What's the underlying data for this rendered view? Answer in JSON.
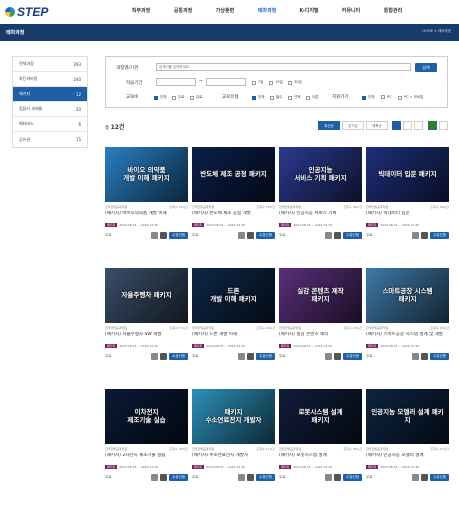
{
  "brand": {
    "logo_text": "STEP"
  },
  "nav": [
    "직무과정",
    "공통과정",
    "가상훈련",
    "테마과정",
    "K-디지털",
    "커뮤니티",
    "통합관리"
  ],
  "nav_active": 3,
  "band": {
    "title": "테마과정",
    "breadcrumb": "HOME > 테마과정"
  },
  "sidebar": [
    {
      "label": "전체과정",
      "count": "293"
    },
    {
      "label": "최단과비용",
      "count": "240"
    },
    {
      "label": "패키지",
      "count": "12"
    },
    {
      "label": "컴퓨터 과제물",
      "count": "20"
    },
    {
      "label": "메타버스",
      "count": "6"
    },
    {
      "label": "공유관",
      "count": "15"
    }
  ],
  "sidebar_active": 2,
  "filter": {
    "label_course": "과정명/기관",
    "search_placeholder": "검색어를 입력하세요",
    "search_button": "검색",
    "label_period": "학습기간",
    "date_sep": "~",
    "period_options": [
      "7일",
      "15일",
      "30일"
    ],
    "label_type": "교육비",
    "type_options": [
      "전체",
      "무료",
      "유료"
    ],
    "label_kind": "교육유형",
    "kind_options": [
      "전체",
      "필수",
      "선택",
      "이론"
    ],
    "label_device": "지원기기",
    "device_options": [
      "전체",
      "PC",
      "PC + 모바일"
    ]
  },
  "count": {
    "prefix": "총",
    "value": "12건"
  },
  "sort": [
    "최신순",
    "인기순",
    "제목순"
  ],
  "cards": [
    {
      "title_img": "바이오 의약품\n개발 이해 패키지",
      "org": "한국한빛공과학원",
      "hours": "조회수 75시간",
      "name": "(패키지) 바이오의약품 개발 이해",
      "date": "2024.08.23 ~ 2024.12.30",
      "badge": "패키지",
      "free": "무료",
      "apply": "수강신청"
    },
    {
      "title_img": "반도체 제조 공정 패키지",
      "org": "한국한빛공과학원",
      "hours": "조회수 75시간",
      "name": "(패키지) 반도체 제조 공정 개발",
      "date": "2024.08.23 ~ 2024.12.30",
      "badge": "패키지",
      "free": "무료",
      "apply": "수강신청"
    },
    {
      "title_img": "인공지능\n서비스 기획 패키지",
      "org": "한국한빛공과학원",
      "hours": "조회수 36시간",
      "name": "(패키지) 인공지능 서비스 기획",
      "date": "2024.08.23 ~ 2024.12.30",
      "badge": "패키지",
      "free": "무료",
      "apply": "수강신청"
    },
    {
      "title_img": "빅데이터 입문 패키지",
      "org": "한국한빛공과학원",
      "hours": "조회수 36시간",
      "name": "(패키지) 빅데이터 입문",
      "date": "2024.08.23 ~ 2024.12.30",
      "badge": "패키지",
      "free": "무료",
      "apply": "수강신청"
    },
    {
      "title_img": "자율주행차 패키지",
      "org": "한국한빛공과학원",
      "hours": "조회수 77시간",
      "name": "(패키지) 자율주행차 SW 개발",
      "date": "2024.08.23 ~ 2024.12.30",
      "badge": "패키지",
      "free": "무료",
      "apply": "수강신청"
    },
    {
      "title_img": "드론\n개발 이해 패키지",
      "org": "한국한빛공과학원",
      "hours": "조회수 26시간",
      "name": "(패키지) 드론 개발 이해",
      "date": "2024.08.23 ~ 2024.12.30",
      "badge": "패키지",
      "free": "무료",
      "apply": "수강신청"
    },
    {
      "title_img": "실감 콘텐츠 제작\n패키지",
      "org": "한국한빛공과학원",
      "hours": "조회수 25시간",
      "name": "(패키지) 실감 콘텐츠 제작",
      "date": "2024.08.23 ~ 2024.12.30",
      "badge": "패키지",
      "free": "무료",
      "apply": "수강신청"
    },
    {
      "title_img": "스마트공장 시스템\n패키지",
      "org": "한국한빛공과학원",
      "hours": "조회수 18시간",
      "name": "(패키지) 스마트공장 시스템 설계 및 개발",
      "date": "2024.08.23 ~ 2024.12.30",
      "badge": "패키지",
      "free": "무료",
      "apply": "수강신청"
    },
    {
      "title_img": "이차전지\n제조기술 실습",
      "org": "한국한빛공과학원",
      "hours": "조회수 36시간",
      "name": "(패키지) 2차전지 제조기술 실습",
      "date": "2024.08.23 ~ 2024.12.30",
      "badge": "패키지",
      "free": "무료",
      "apply": "수강신청"
    },
    {
      "title_img": "패키지\n수소연료전지 개발자",
      "org": "한국한빛공과학원",
      "hours": "조회수 17시간",
      "name": "(패키지) 수소연료전지 개발자",
      "date": "2024.08.23 ~ 2024.12.30",
      "badge": "패키지",
      "free": "무료",
      "apply": "수강신청"
    },
    {
      "title_img": "로봇시스템 설계\n패키지",
      "org": "한국한빛공과학원",
      "hours": "조회수 36시간",
      "name": "(패키지) 로봇시스템 설계",
      "date": "2024.08.23 ~ 2024.12.30",
      "badge": "패키지",
      "free": "무료",
      "apply": "수강신청"
    },
    {
      "title_img": "인공지능 모델러 설계 패키지",
      "org": "한국한빛공과학원",
      "hours": "조회수 27시간",
      "name": "(패키지) 인공지능 모델러 설계",
      "date": "2024.08.23 ~ 2024.12.30",
      "badge": "패키지",
      "free": "무료",
      "apply": "수강신청"
    }
  ],
  "thumb_colors": [
    "#2a7fc4",
    "#0b1f4a",
    "#2b3a8f",
    "#1d2f7a",
    "#3a4f6a",
    "#0e2748",
    "#5a2f7c",
    "#3f79a8",
    "#0a1a36",
    "#2d8fb8",
    "#101d3a",
    "#0d2440"
  ]
}
